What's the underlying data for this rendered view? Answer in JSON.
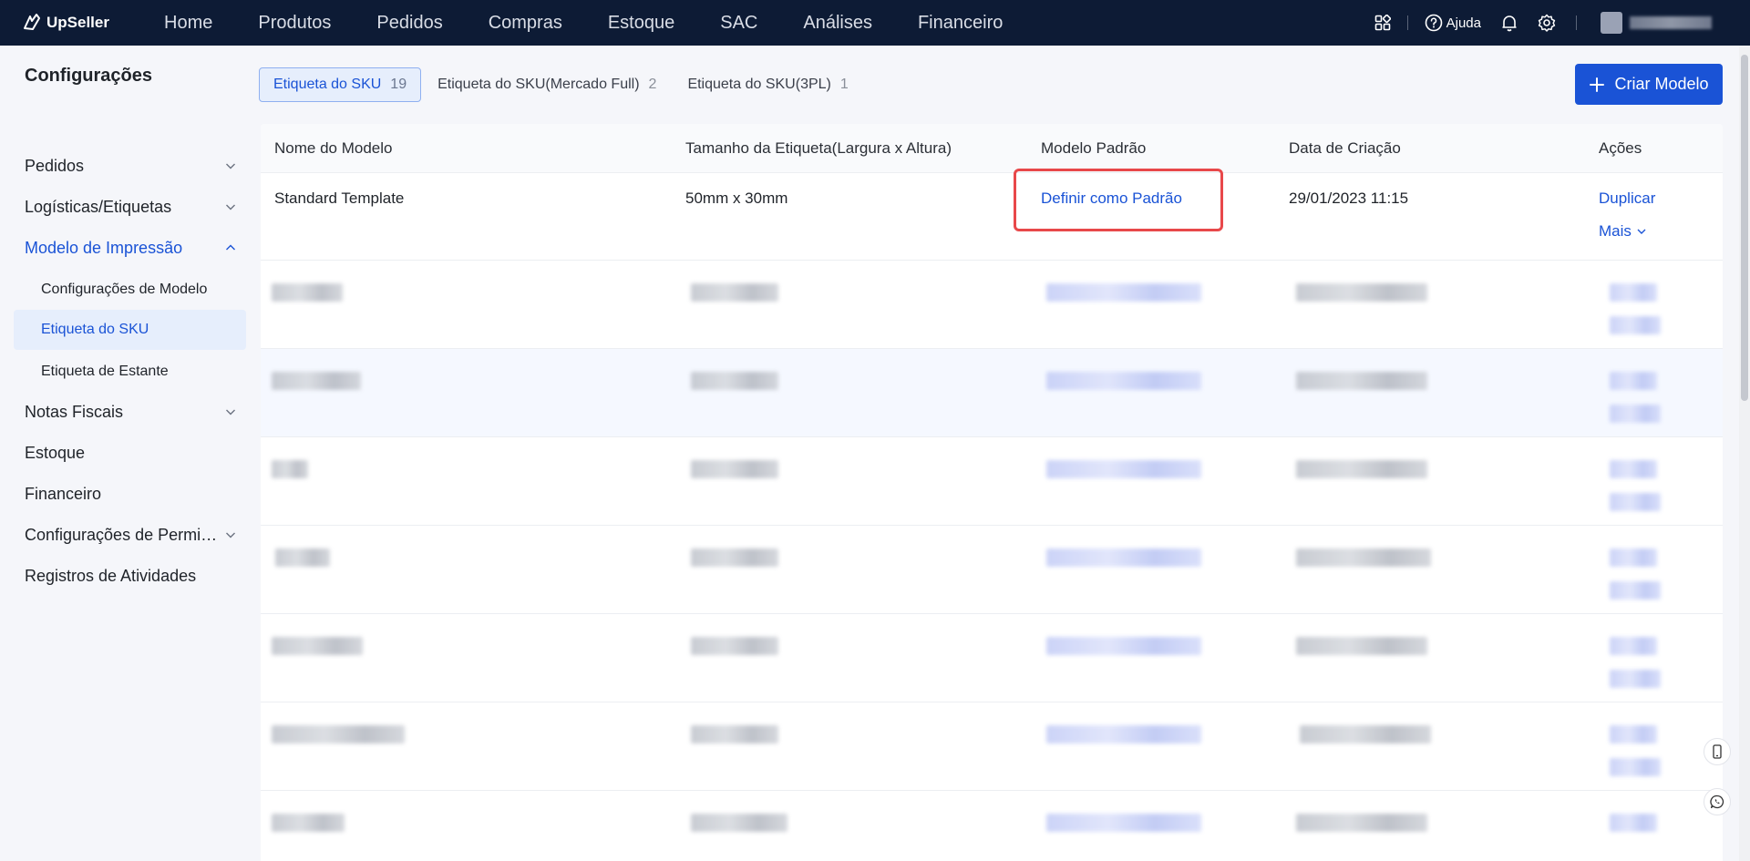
{
  "app": {
    "name": "UpSeller"
  },
  "nav": {
    "items": [
      "Home",
      "Produtos",
      "Pedidos",
      "Compras",
      "Estoque",
      "SAC",
      "Análises",
      "Financeiro"
    ]
  },
  "topright": {
    "help_label": "Ajuda"
  },
  "sidebar": {
    "title": "Configurações",
    "items": [
      {
        "label": "Pedidos"
      },
      {
        "label": "Logísticas/Etiquetas"
      },
      {
        "label": "Modelo de Impressão"
      },
      {
        "label": "Configurações de Modelo"
      },
      {
        "label": "Etiqueta do SKU"
      },
      {
        "label": "Etiqueta de Estante"
      },
      {
        "label": "Notas Fiscais"
      },
      {
        "label": "Estoque"
      },
      {
        "label": "Financeiro"
      },
      {
        "label": "Configurações de Permi…"
      },
      {
        "label": "Registros de Atividades"
      }
    ]
  },
  "tabs": [
    {
      "label": "Etiqueta do SKU",
      "count": "19"
    },
    {
      "label": "Etiqueta do SKU(Mercado Full)",
      "count": "2"
    },
    {
      "label": "Etiqueta do SKU(3PL)",
      "count": "1"
    }
  ],
  "create_button": {
    "label": "Criar Modelo"
  },
  "table": {
    "headers": [
      "Nome do Modelo",
      "Tamanho da Etiqueta(Largura x Altura)",
      "Modelo Padrão",
      "Data de Criação",
      "Ações"
    ],
    "first_row": {
      "name": "Standard Template",
      "size": "50mm x 30mm",
      "default_action": "Definir como Padrão",
      "created": "29/01/2023 11:15",
      "action_duplicate": "Duplicar",
      "action_more": "Mais"
    }
  },
  "colors": {
    "topbar": "#0d1b35",
    "accent": "#1a53d6",
    "highlight": "#e8484a"
  }
}
